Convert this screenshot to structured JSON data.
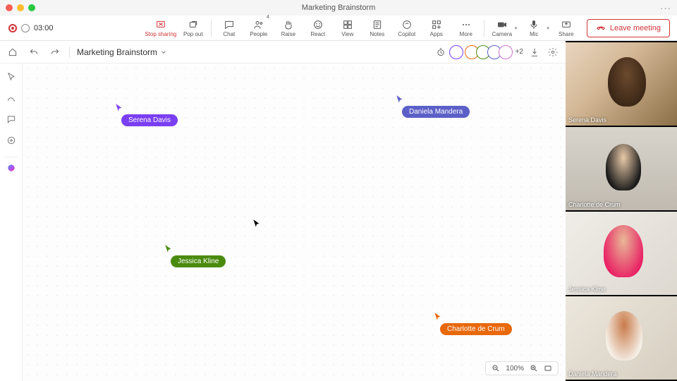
{
  "window": {
    "title": "Marketing Brainstorm"
  },
  "recording": {
    "time": "03:00"
  },
  "toolbar": {
    "stop_sharing": "Stop sharing",
    "pop_out": "Pop out",
    "chat": "Chat",
    "people": "People",
    "people_count": "4",
    "raise": "Raise",
    "react": "React",
    "view": "View",
    "notes": "Notes",
    "copilot": "Copilot",
    "apps": "Apps",
    "more": "More",
    "camera": "Camera",
    "mic": "Mic",
    "share": "Share",
    "leave": "Leave meeting"
  },
  "whiteboard": {
    "title": "Marketing Brainstorm",
    "overflow": "+2",
    "zoom": "100%",
    "cursors": {
      "serena": "Serena Davis",
      "daniela": "Daniela Mandera",
      "jessica": "Jessica Kline",
      "charlotte": "Charlotte de Crum"
    },
    "colors": {
      "serena": "#7b3ff2",
      "daniela": "#5b5fc7",
      "jessica": "#4a8b0e",
      "charlotte": "#e8680c"
    }
  },
  "participants": [
    {
      "name": "Serena Davis"
    },
    {
      "name": "Charlotte de Crum"
    },
    {
      "name": "Jessica Kline"
    },
    {
      "name": "Daniela Mandera"
    }
  ]
}
